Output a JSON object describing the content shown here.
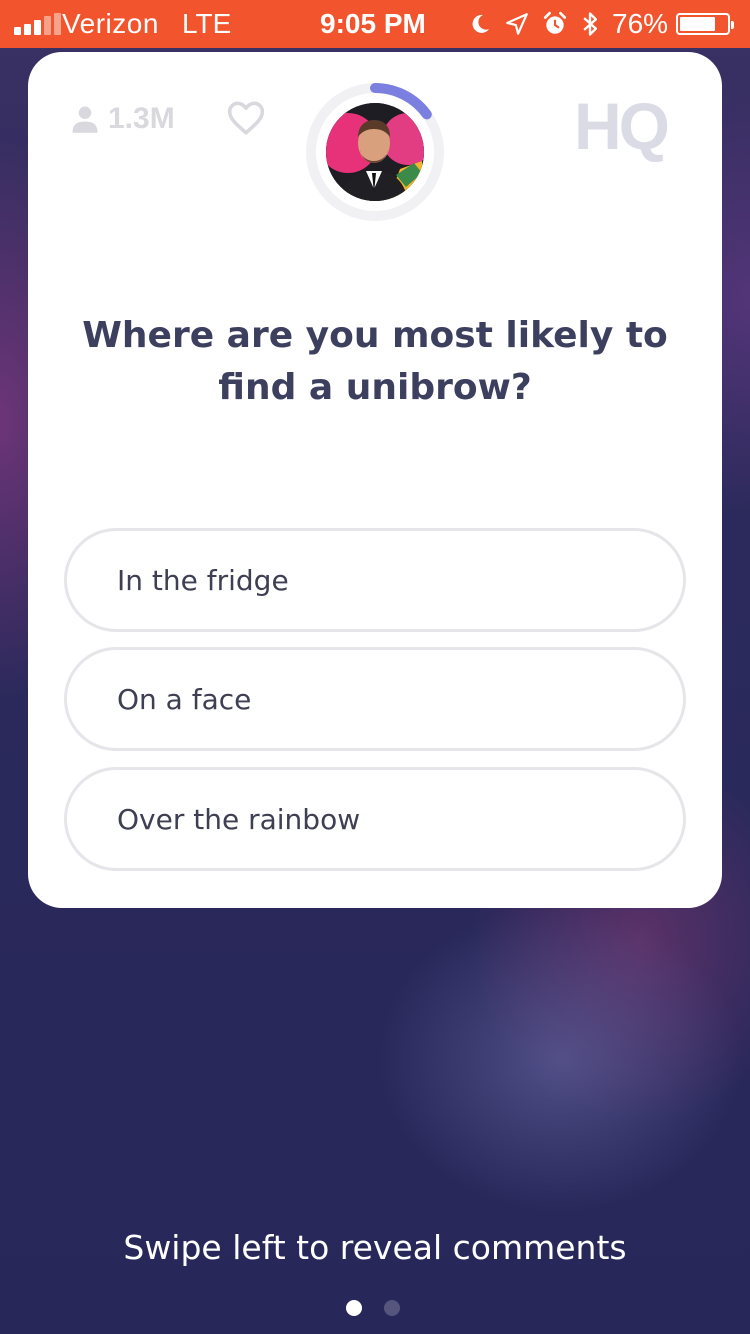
{
  "status_bar": {
    "carrier": "Verizon",
    "network": "LTE",
    "time": "9:05 PM",
    "battery_percent": "76%",
    "battery_level": 0.76,
    "icons": [
      "moon-icon",
      "location-arrow-icon",
      "alarm-icon",
      "bluetooth-icon"
    ],
    "background_color": "#f2542d"
  },
  "header": {
    "viewer_count": "1.3M",
    "logo": "HQ",
    "timer_progress": 0.15,
    "timer_color": "#7b7fe0"
  },
  "question": {
    "text": "Where are you most likely to find a unibrow?"
  },
  "answers": [
    {
      "label": "In the fridge"
    },
    {
      "label": "On a face"
    },
    {
      "label": "Over the rainbow"
    }
  ],
  "footer": {
    "hint": "Swipe left to reveal comments",
    "page_count": 2,
    "active_page": 0
  }
}
